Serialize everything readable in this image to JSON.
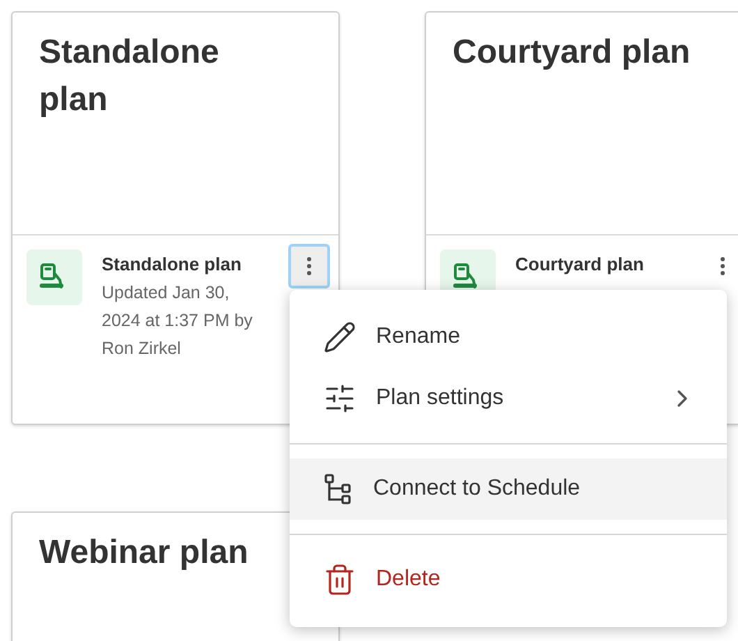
{
  "cards": [
    {
      "title": "Standalone plan",
      "name": "Standalone plan",
      "updated": "Updated Jan 30, 2024 at 1:37 PM by Ron Zirkel",
      "menu_open": true
    },
    {
      "title": "Courtyard plan",
      "name": "Courtyard plan"
    },
    {
      "title": "Webinar plan"
    }
  ],
  "menu": {
    "items": [
      {
        "kind": "edit",
        "label": "Rename",
        "highlighted": false
      },
      {
        "kind": "submenu",
        "label": "Plan settings",
        "highlighted": false
      },
      {
        "kind": "divider"
      },
      {
        "kind": "connect",
        "label": "Connect to Schedule",
        "highlighted": true
      },
      {
        "kind": "divider"
      },
      {
        "kind": "danger",
        "label": "Delete",
        "highlighted": false
      }
    ]
  }
}
